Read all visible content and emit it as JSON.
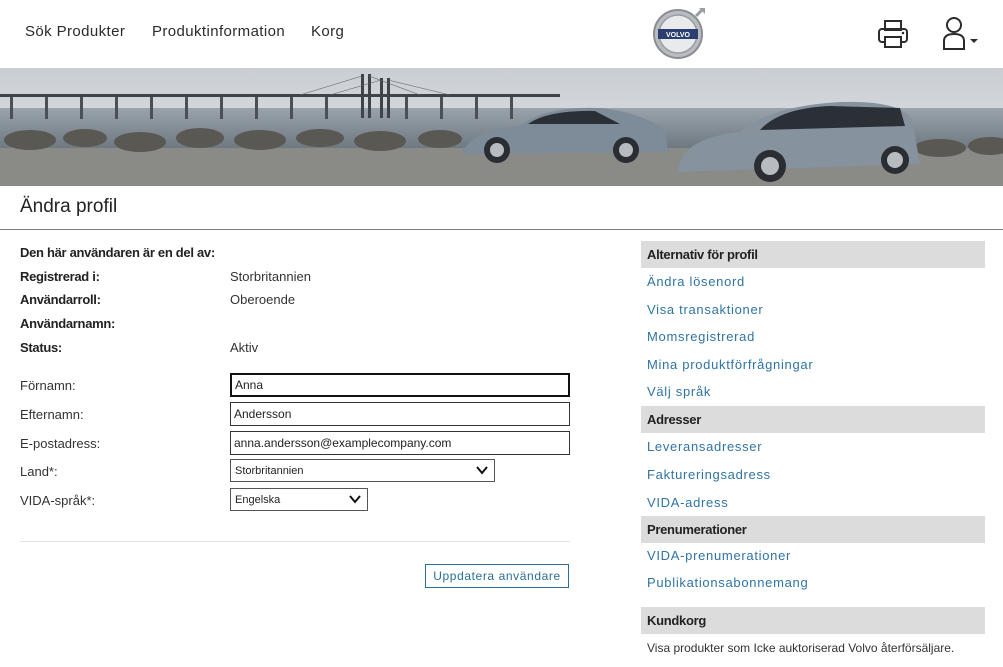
{
  "nav": {
    "search_products": "Sök Produkter",
    "product_info": "Produktinformation",
    "cart": "Korg"
  },
  "brand": {
    "logo_text": "VOLVO"
  },
  "header_icons": {
    "print": "printer-icon",
    "user": "user-icon",
    "caret": "caret-down-icon"
  },
  "page": {
    "title": "Ändra profil"
  },
  "info": {
    "member_of_label": "Den här användaren är en del av:",
    "member_of_value": "",
    "registered_label": "Registrerad i:",
    "registered_value": "Storbritannien",
    "role_label": "Användarroll:",
    "role_value": "Oberoende",
    "username_label": "Användarnamn:",
    "username_value": "",
    "status_label": "Status:",
    "status_value": "Aktiv"
  },
  "form": {
    "first_name_label": "Förnamn:",
    "first_name_value": "Anna",
    "last_name_label": "Efternamn:",
    "last_name_value": "Andersson",
    "email_label": "E-postadress:",
    "email_value": "anna.andersson@examplecompany.com",
    "country_label": "Land*:",
    "country_value": "Storbritannien",
    "vida_lang_label": "VIDA-språk*:",
    "vida_lang_value": "Engelska",
    "update_button": "Uppdatera användare"
  },
  "sidebar": {
    "profile_header": "Alternativ för profil",
    "profile_links": [
      "Ändra lösenord",
      "Visa transaktioner",
      "Momsregistrerad",
      "Mina produktförfrågningar",
      "Välj språk"
    ],
    "addresses_header": "Adresser",
    "address_links": [
      "Leveransadresser",
      "Faktureringsadress",
      "VIDA-adress"
    ],
    "subscriptions_header": "Prenumerationer",
    "subscription_links": [
      "VIDA-prenumerationer",
      "Publikationsabonnemang"
    ],
    "cart_header": "Kundkorg",
    "cart_text": "Visa produkter som Icke auktoriserad Volvo återförsäljare."
  },
  "colors": {
    "link": "#2f74a3",
    "section_bg": "#dcdcdc",
    "button": "#2a6f96"
  }
}
